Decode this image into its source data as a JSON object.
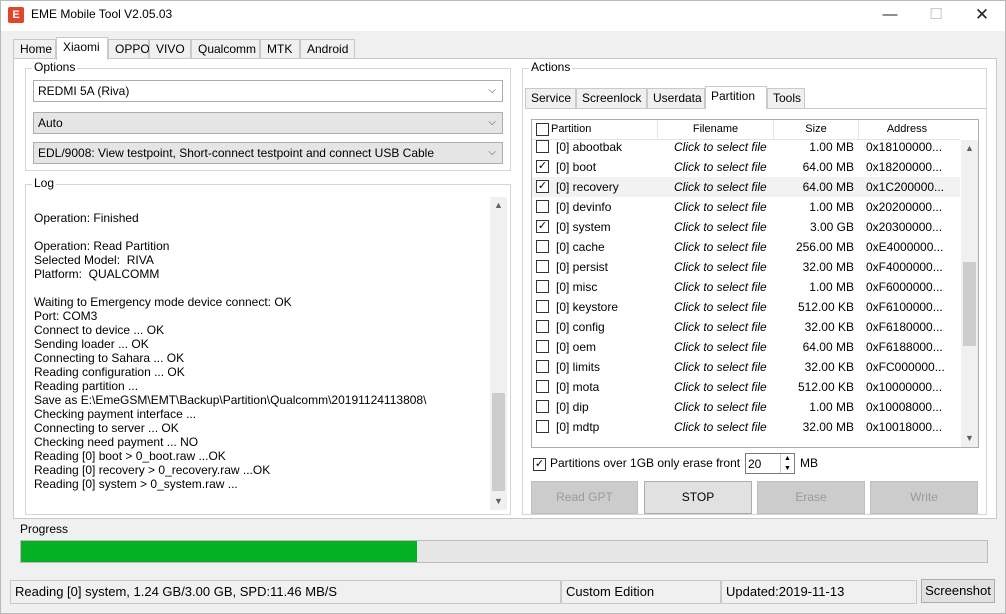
{
  "window": {
    "title": "EME Mobile Tool V2.05.03",
    "icon_letter": "E"
  },
  "titlebar": {
    "minimize": "—",
    "maximize": "☐",
    "close": "✕"
  },
  "main_tabs": [
    "Home",
    "Xiaomi",
    "OPPO",
    "VIVO",
    "Qualcomm",
    "MTK",
    "Android"
  ],
  "main_tabs_active": "Xiaomi",
  "options": {
    "title": "Options",
    "model": "REDMI 5A (Riva)",
    "mode": "Auto",
    "connection": "EDL/9008: View testpoint, Short-connect testpoint and connect USB Cable"
  },
  "log": {
    "title": "Log",
    "text": "\nOperation: Finished\n\nOperation: Read Partition\nSelected Model:  RIVA\nPlatform:  QUALCOMM\n\nWaiting to Emergency mode device connect: OK\nPort: COM3\nConnect to device ... OK\nSending loader ... OK\nConnecting to Sahara ... OK\nReading configuration ... OK\nReading partition ...\nSave as E:\\EmeGSM\\EMT\\Backup\\Partition\\Qualcomm\\20191124113808\\\nChecking payment interface ...\nConnecting to server ... OK\nChecking need payment ... NO\nReading [0] boot > 0_boot.raw ...OK\nReading [0] recovery > 0_recovery.raw ...OK\nReading [0] system > 0_system.raw ..."
  },
  "actions": {
    "title": "Actions",
    "tabs": [
      "Service",
      "Screenlock",
      "Userdata",
      "Partition",
      "Tools"
    ],
    "active_tab": "Partition",
    "columns": [
      "Partition",
      "Filename",
      "Size",
      "Address"
    ],
    "rows": [
      {
        "checked": false,
        "name": "[0] abootbak",
        "file": "Click to select file",
        "size": "1.00 MB",
        "address": "0x18100000..."
      },
      {
        "checked": true,
        "name": "[0] boot",
        "file": "Click to select file",
        "size": "64.00 MB",
        "address": "0x18200000..."
      },
      {
        "checked": true,
        "name": "[0] recovery",
        "file": "Click to select file",
        "size": "64.00 MB",
        "address": "0x1C200000..."
      },
      {
        "checked": false,
        "name": "[0] devinfo",
        "file": "Click to select file",
        "size": "1.00 MB",
        "address": "0x20200000..."
      },
      {
        "checked": true,
        "name": "[0] system",
        "file": "Click to select file",
        "size": "3.00 GB",
        "address": "0x20300000..."
      },
      {
        "checked": false,
        "name": "[0] cache",
        "file": "Click to select file",
        "size": "256.00 MB",
        "address": "0xE4000000..."
      },
      {
        "checked": false,
        "name": "[0] persist",
        "file": "Click to select file",
        "size": "32.00 MB",
        "address": "0xF4000000..."
      },
      {
        "checked": false,
        "name": "[0] misc",
        "file": "Click to select file",
        "size": "1.00 MB",
        "address": "0xF6000000..."
      },
      {
        "checked": false,
        "name": "[0] keystore",
        "file": "Click to select file",
        "size": "512.00 KB",
        "address": "0xF6100000..."
      },
      {
        "checked": false,
        "name": "[0] config",
        "file": "Click to select file",
        "size": "32.00 KB",
        "address": "0xF6180000..."
      },
      {
        "checked": false,
        "name": "[0] oem",
        "file": "Click to select file",
        "size": "64.00 MB",
        "address": "0xF6188000..."
      },
      {
        "checked": false,
        "name": "[0] limits",
        "file": "Click to select file",
        "size": "32.00 KB",
        "address": "0xFC000000..."
      },
      {
        "checked": false,
        "name": "[0] mota",
        "file": "Click to select file",
        "size": "512.00 KB",
        "address": "0x10000000..."
      },
      {
        "checked": false,
        "name": "[0] dip",
        "file": "Click to select file",
        "size": "1.00 MB",
        "address": "0x10008000..."
      },
      {
        "checked": false,
        "name": "[0] mdtp",
        "file": "Click to select file",
        "size": "32.00 MB",
        "address": "0x10018000..."
      }
    ],
    "erase_option": {
      "checked": true,
      "label": "Partitions over 1GB only erase front",
      "value": "20",
      "unit": "MB"
    },
    "buttons": {
      "read_gpt": "Read GPT",
      "stop": "STOP",
      "erase": "Erase",
      "write": "Write"
    }
  },
  "progress": {
    "label": "Progress",
    "fraction": 0.41
  },
  "status": {
    "message": "Reading [0] system, 1.24 GB/3.00 GB, SPD:11.46 MB/S",
    "edition": "Custom Edition",
    "updated": "Updated:2019-11-13",
    "screenshot_button": "Screenshot"
  }
}
